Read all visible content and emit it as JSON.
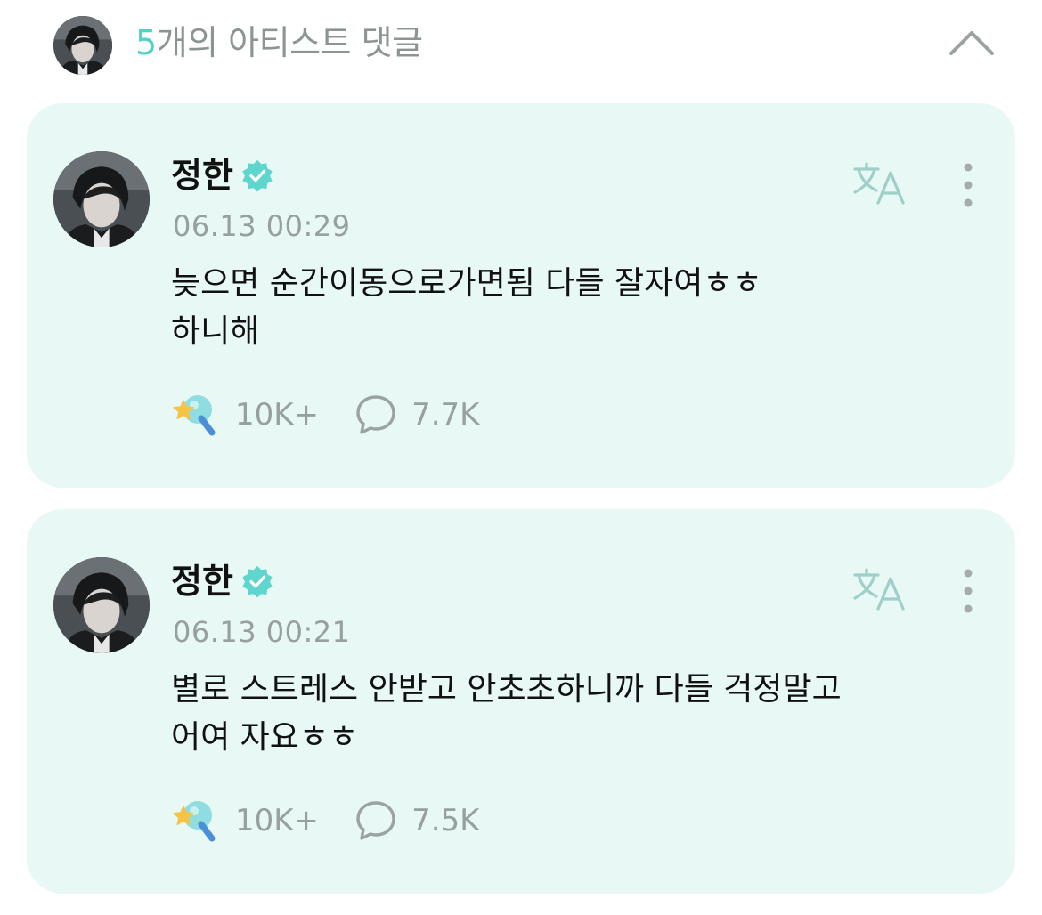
{
  "header": {
    "count": "5",
    "title_suffix": "개의 아티스트 댓글",
    "accent_color": "#4fd1c8"
  },
  "comments": [
    {
      "author": "정한",
      "timestamp": "06.13 00:29",
      "body": "늦으면 순간이동으로가면됨 다들 잘자여ㅎㅎ\n하니해",
      "likes": "10K+",
      "replies": "7.7K"
    },
    {
      "author": "정한",
      "timestamp": "06.13 00:21",
      "body": "별로 스트레스 안받고 안초초하니까 다들 걱정말고\n어여 자요ㅎㅎ",
      "likes": "10K+",
      "replies": "7.5K"
    }
  ],
  "icons": {
    "collapse": "chevron-up-icon",
    "verified": "verified-badge-icon",
    "translate": "translate-icon",
    "more": "more-vertical-icon",
    "like": "star-lightstick-icon",
    "reply": "speech-bubble-icon"
  },
  "colors": {
    "card_background": "#e8f8f5",
    "muted_text": "#97a09e",
    "verified": "#4fd1c8"
  }
}
